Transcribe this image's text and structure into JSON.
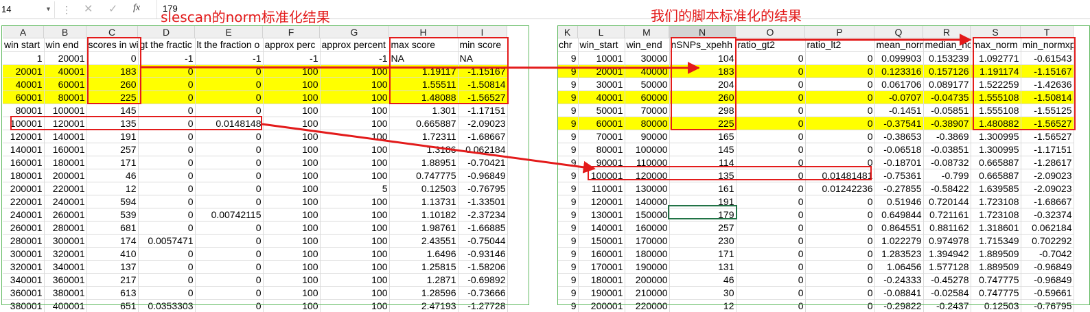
{
  "formula_bar": {
    "name_box": "14",
    "cancel_icon": "✕",
    "enter_icon": "✓",
    "fx_label": "fx",
    "value": "179"
  },
  "annotations": {
    "left_title": "slescan的norm标准化结果",
    "right_title": "我们的脚本标准化的结果"
  },
  "left_sheet": {
    "column_letters": [
      "A",
      "B",
      "C",
      "D",
      "E",
      "F",
      "G",
      "H",
      "I"
    ],
    "headers": [
      "win start",
      "win end",
      "scores in wi",
      "gt the fractic",
      "lt the fraction o",
      "approx perc",
      "approx percent",
      "max score",
      "min score"
    ],
    "rows": [
      [
        "1",
        "20001",
        "0",
        "-1",
        "-1",
        "-1",
        "-1",
        "NA",
        "NA"
      ],
      [
        "20001",
        "40001",
        "183",
        "0",
        "0",
        "100",
        "100",
        "1.19117",
        "-1.15167"
      ],
      [
        "40001",
        "60001",
        "260",
        "0",
        "0",
        "100",
        "100",
        "1.55511",
        "-1.50814"
      ],
      [
        "60001",
        "80001",
        "225",
        "0",
        "0",
        "100",
        "100",
        "1.48088",
        "-1.56527"
      ],
      [
        "80001",
        "100001",
        "145",
        "0",
        "0",
        "100",
        "100",
        "1.301",
        "-1.17151"
      ],
      [
        "100001",
        "120001",
        "135",
        "0",
        "0.0148148",
        "100",
        "100",
        "0.665887",
        "-2.09023"
      ],
      [
        "120001",
        "140001",
        "191",
        "0",
        "0",
        "100",
        "100",
        "1.72311",
        "-1.68667"
      ],
      [
        "140001",
        "160001",
        "257",
        "0",
        "0",
        "100",
        "100",
        "1.3186",
        "0.062184"
      ],
      [
        "160001",
        "180001",
        "171",
        "0",
        "0",
        "100",
        "100",
        "1.88951",
        "-0.70421"
      ],
      [
        "180001",
        "200001",
        "46",
        "0",
        "0",
        "100",
        "100",
        "0.747775",
        "-0.96849"
      ],
      [
        "200001",
        "220001",
        "12",
        "0",
        "0",
        "100",
        "5",
        "0.12503",
        "-0.76795"
      ],
      [
        "220001",
        "240001",
        "594",
        "0",
        "0",
        "100",
        "100",
        "1.13731",
        "-1.33501"
      ],
      [
        "240001",
        "260001",
        "539",
        "0",
        "0.00742115",
        "100",
        "100",
        "1.10182",
        "-2.37234"
      ],
      [
        "260001",
        "280001",
        "681",
        "0",
        "0",
        "100",
        "100",
        "1.98761",
        "-1.66885"
      ],
      [
        "280001",
        "300001",
        "174",
        "0.0057471",
        "0",
        "100",
        "100",
        "2.43551",
        "-0.75044"
      ],
      [
        "300001",
        "320001",
        "410",
        "0",
        "0",
        "100",
        "100",
        "1.6496",
        "-0.93146"
      ],
      [
        "320001",
        "340001",
        "137",
        "0",
        "0",
        "100",
        "100",
        "1.25815",
        "-1.58206"
      ],
      [
        "340001",
        "360001",
        "217",
        "0",
        "0",
        "100",
        "100",
        "1.2871",
        "-0.69892"
      ],
      [
        "360001",
        "380001",
        "613",
        "0",
        "0",
        "100",
        "100",
        "1.28596",
        "-0.73666"
      ],
      [
        "380001",
        "400001",
        "651",
        "0.0353303",
        "0",
        "100",
        "100",
        "2.47193",
        "-1.27728"
      ]
    ],
    "highlight_rows": [
      1,
      2,
      3
    ]
  },
  "right_sheet": {
    "column_letters": [
      "K",
      "L",
      "M",
      "N",
      "O",
      "P",
      "Q",
      "R",
      "S",
      "T"
    ],
    "headers": [
      "chr",
      "win_start",
      "win_end",
      "nSNPs_xpehh",
      "ratio_gt2",
      "ratio_lt2",
      "mean_norm",
      "median_no",
      "max_norm",
      "min_normxp"
    ],
    "rows": [
      [
        "9",
        "10001",
        "30000",
        "104",
        "0",
        "0",
        "0.099903",
        "0.153239",
        "1.092771",
        "-0.61543"
      ],
      [
        "9",
        "20001",
        "40000",
        "183",
        "0",
        "0",
        "0.123316",
        "0.157126",
        "1.191174",
        "-1.15167"
      ],
      [
        "9",
        "30001",
        "50000",
        "204",
        "0",
        "0",
        "0.061706",
        "0.089177",
        "1.522259",
        "-1.42636"
      ],
      [
        "9",
        "40001",
        "60000",
        "260",
        "0",
        "0",
        "-0.0707",
        "-0.04735",
        "1.555108",
        "-1.50814"
      ],
      [
        "9",
        "50001",
        "70000",
        "298",
        "0",
        "0",
        "-0.1451",
        "-0.05851",
        "1.555108",
        "-1.55125"
      ],
      [
        "9",
        "60001",
        "80000",
        "225",
        "0",
        "0",
        "-0.37541",
        "-0.38907",
        "1.480882",
        "-1.56527"
      ],
      [
        "9",
        "70001",
        "90000",
        "165",
        "0",
        "0",
        "-0.38653",
        "-0.3869",
        "1.300995",
        "-1.56527"
      ],
      [
        "9",
        "80001",
        "100000",
        "145",
        "0",
        "0",
        "-0.06518",
        "-0.03851",
        "1.300995",
        "-1.17151"
      ],
      [
        "9",
        "90001",
        "110000",
        "114",
        "0",
        "0",
        "-0.18701",
        "-0.08732",
        "0.665887",
        "-1.28617"
      ],
      [
        "9",
        "100001",
        "120000",
        "135",
        "0",
        "0.01481481",
        "-0.75361",
        "-0.799",
        "0.665887",
        "-2.09023"
      ],
      [
        "9",
        "110001",
        "130000",
        "161",
        "0",
        "0.01242236",
        "-0.27855",
        "-0.58422",
        "1.639585",
        "-2.09023"
      ],
      [
        "9",
        "120001",
        "140000",
        "191",
        "0",
        "0",
        "0.51946",
        "0.720144",
        "1.723108",
        "-1.68667"
      ],
      [
        "9",
        "130001",
        "150000",
        "179",
        "0",
        "0",
        "0.649844",
        "0.721161",
        "1.723108",
        "-0.32374"
      ],
      [
        "9",
        "140001",
        "160000",
        "257",
        "0",
        "0",
        "0.864551",
        "0.881162",
        "1.318601",
        "0.062184"
      ],
      [
        "9",
        "150001",
        "170000",
        "230",
        "0",
        "0",
        "1.022279",
        "0.974978",
        "1.715349",
        "0.702292"
      ],
      [
        "9",
        "160001",
        "180000",
        "171",
        "0",
        "0",
        "1.283523",
        "1.394942",
        "1.889509",
        "-0.7042"
      ],
      [
        "9",
        "170001",
        "190000",
        "131",
        "0",
        "0",
        "1.06456",
        "1.577128",
        "1.889509",
        "-0.96849"
      ],
      [
        "9",
        "180001",
        "200000",
        "46",
        "0",
        "0",
        "-0.24333",
        "-0.45278",
        "0.747775",
        "-0.96849"
      ],
      [
        "9",
        "190001",
        "210000",
        "30",
        "0",
        "0",
        "-0.08841",
        "-0.02584",
        "0.747775",
        "-0.59661"
      ],
      [
        "9",
        "200001",
        "220000",
        "12",
        "0",
        "0",
        "-0.29822",
        "-0.2437",
        "0.12503",
        "-0.76795"
      ]
    ],
    "highlight_rows": [
      1,
      3,
      5
    ]
  },
  "colors": {
    "annotation": "#e31b1b",
    "highlight": "#ffff00",
    "frame": "#5cb85c",
    "selection": "#217346"
  }
}
